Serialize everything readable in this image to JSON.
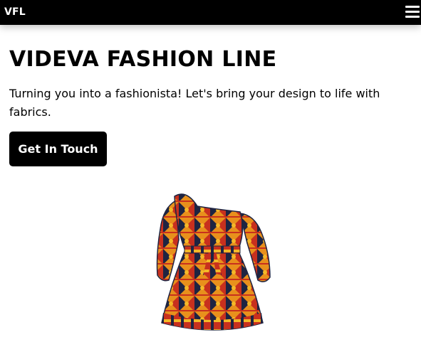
{
  "nav": {
    "brand": "VFL",
    "menu_icon": "hamburger-menu-icon"
  },
  "hero": {
    "title": "VIDEVA FASHION LINE",
    "tagline": "Turning you into a fashionista! Let's bring your design to life with fabrics.",
    "cta_label": "Get In Touch"
  },
  "colors": {
    "nav_bg": "#000000",
    "nav_text": "#ffffff",
    "button_bg": "#000000",
    "button_text": "#ffffff",
    "fabric_navy": "#1e2442",
    "fabric_orange": "#e8901c",
    "fabric_red": "#c8301e",
    "fabric_yellow": "#f4b828"
  }
}
